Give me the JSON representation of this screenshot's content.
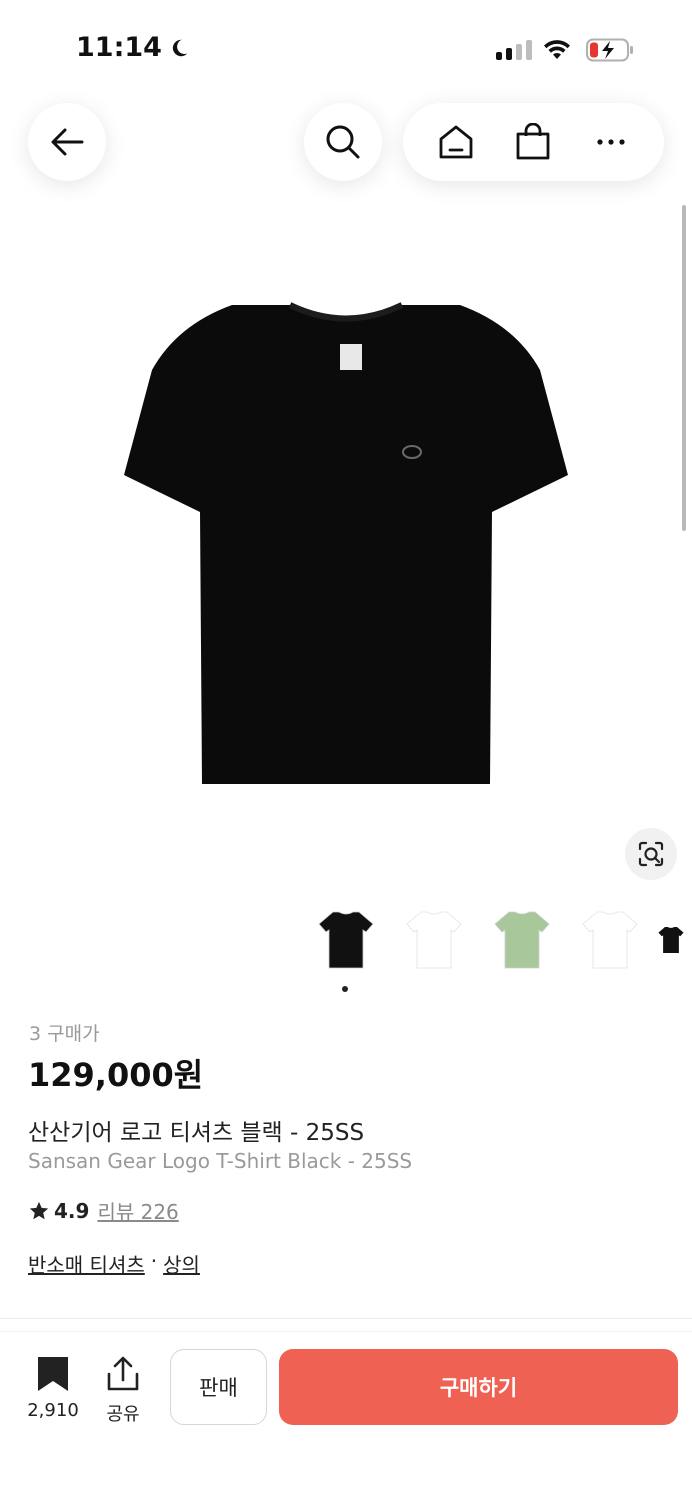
{
  "status": {
    "time": "11:14",
    "colors": {
      "battery_low": "#e5372e"
    }
  },
  "nav": {
    "back_icon": "arrow-left-icon",
    "search_icon": "search-icon",
    "home_icon": "home-icon",
    "bag_icon": "shopping-bag-icon",
    "more_icon": "more-dots-icon"
  },
  "product": {
    "trade_count": "3 구매가",
    "price": "129,000원",
    "title_ko": "산산기어 로고 티셔츠 블랙 - 25SS",
    "title_en": "Sansan Gear Logo T-Shirt Black - 25SS",
    "rating": "4.9",
    "review_label": "리뷰 226",
    "category_1": "반소매 티셔츠",
    "category_sep": "·",
    "category_2": "상의"
  },
  "thumbnails": [
    {
      "color": "#111111",
      "name": "black"
    },
    {
      "color": "#ffffff",
      "name": "white"
    },
    {
      "color": "#a8c79a",
      "name": "green"
    },
    {
      "color": "#ffffff",
      "name": "white-2"
    },
    {
      "color": "#111111",
      "name": "black-2"
    }
  ],
  "bottom": {
    "bookmark_count": "2,910",
    "share_label": "공유",
    "sell_label": "판매",
    "buy_label": "구매하기",
    "colors": {
      "buy": "#ef6253"
    }
  }
}
